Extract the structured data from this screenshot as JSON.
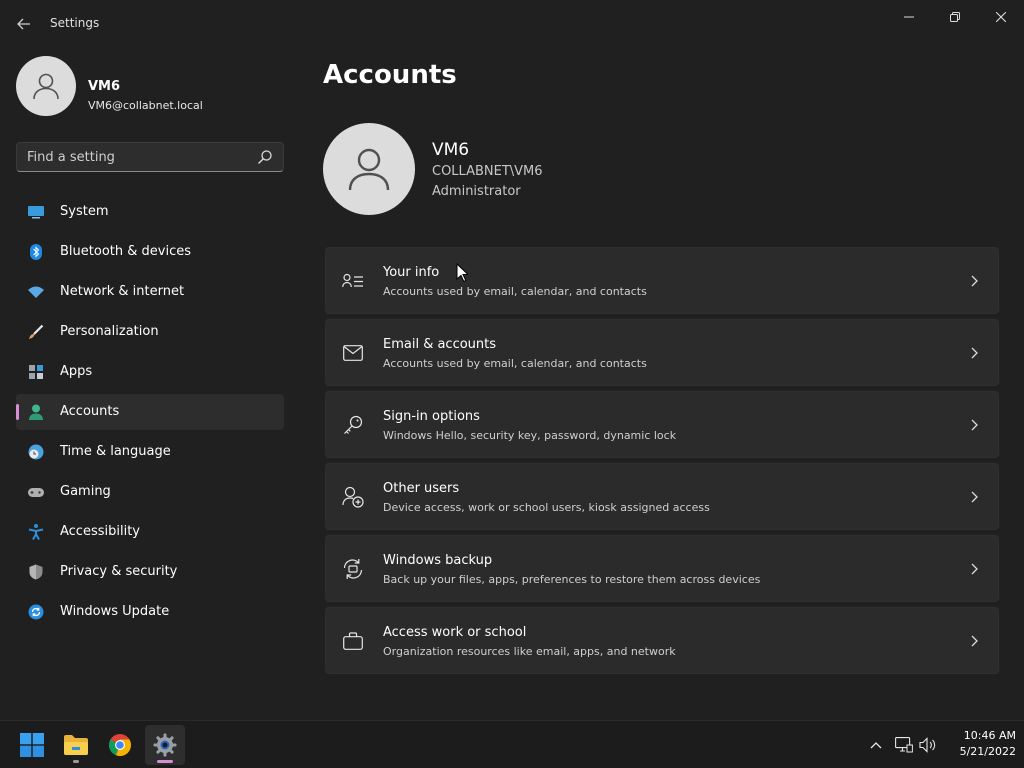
{
  "window": {
    "app_title": "Settings",
    "controls": {
      "minimize": "minimize",
      "maximize": "maximize",
      "close": "close"
    }
  },
  "sidebar": {
    "user": {
      "name": "VM6",
      "email": "VM6@collabnet.local"
    },
    "search": {
      "placeholder": "Find a setting",
      "value": ""
    },
    "items": [
      {
        "label": "System",
        "icon": "monitor-icon",
        "color": "#3a9bdc",
        "active": false
      },
      {
        "label": "Bluetooth & devices",
        "icon": "bluetooth-icon",
        "color": "#1e88e5",
        "active": false
      },
      {
        "label": "Network & internet",
        "icon": "wifi-icon",
        "color": "#5aa9e6",
        "active": false
      },
      {
        "label": "Personalization",
        "icon": "paintbrush-icon",
        "color": "#e9a15b",
        "active": false
      },
      {
        "label": "Apps",
        "icon": "apps-icon",
        "color": "#9aa5b1",
        "active": false
      },
      {
        "label": "Accounts",
        "icon": "person-icon",
        "color": "#3fb68b",
        "active": true
      },
      {
        "label": "Time & language",
        "icon": "globe-clock-icon",
        "color": "#4aa3df",
        "active": false
      },
      {
        "label": "Gaming",
        "icon": "gamepad-icon",
        "color": "#b0b0b0",
        "active": false
      },
      {
        "label": "Accessibility",
        "icon": "accessibility-icon",
        "color": "#2f8fd8",
        "active": false
      },
      {
        "label": "Privacy & security",
        "icon": "shield-icon",
        "color": "#8c8c8c",
        "active": false
      },
      {
        "label": "Windows Update",
        "icon": "update-icon",
        "color": "#2b8fe0",
        "active": false
      }
    ]
  },
  "main": {
    "title": "Accounts",
    "profile": {
      "name": "VM6",
      "domain": "COLLABNET\\VM6",
      "role": "Administrator"
    },
    "cards": [
      {
        "title": "Your info",
        "subtitle": "Accounts used by email, calendar, and contacts",
        "icon": "contact-card-icon"
      },
      {
        "title": "Email & accounts",
        "subtitle": "Accounts used by email, calendar, and contacts",
        "icon": "mail-icon"
      },
      {
        "title": "Sign-in options",
        "subtitle": "Windows Hello, security key, password, dynamic lock",
        "icon": "key-icon"
      },
      {
        "title": "Other users",
        "subtitle": "Device access, work or school users, kiosk assigned access",
        "icon": "person-add-icon"
      },
      {
        "title": "Windows backup",
        "subtitle": "Back up your files, apps, preferences to restore them across devices",
        "icon": "backup-icon"
      },
      {
        "title": "Access work or school",
        "subtitle": "Organization resources like email, apps, and network",
        "icon": "briefcase-icon"
      }
    ]
  },
  "taskbar": {
    "apps": [
      {
        "name": "start-button",
        "icon": "windows-logo-icon"
      },
      {
        "name": "file-explorer-button",
        "icon": "folder-icon"
      },
      {
        "name": "chrome-button",
        "icon": "chrome-icon"
      },
      {
        "name": "settings-taskbar-button",
        "icon": "gear-icon"
      }
    ],
    "clock": {
      "time": "10:46 AM",
      "date": "5/21/2022"
    }
  },
  "colors": {
    "accent": "#d68fd6",
    "background": "#202020",
    "card": "#2b2b2b"
  }
}
